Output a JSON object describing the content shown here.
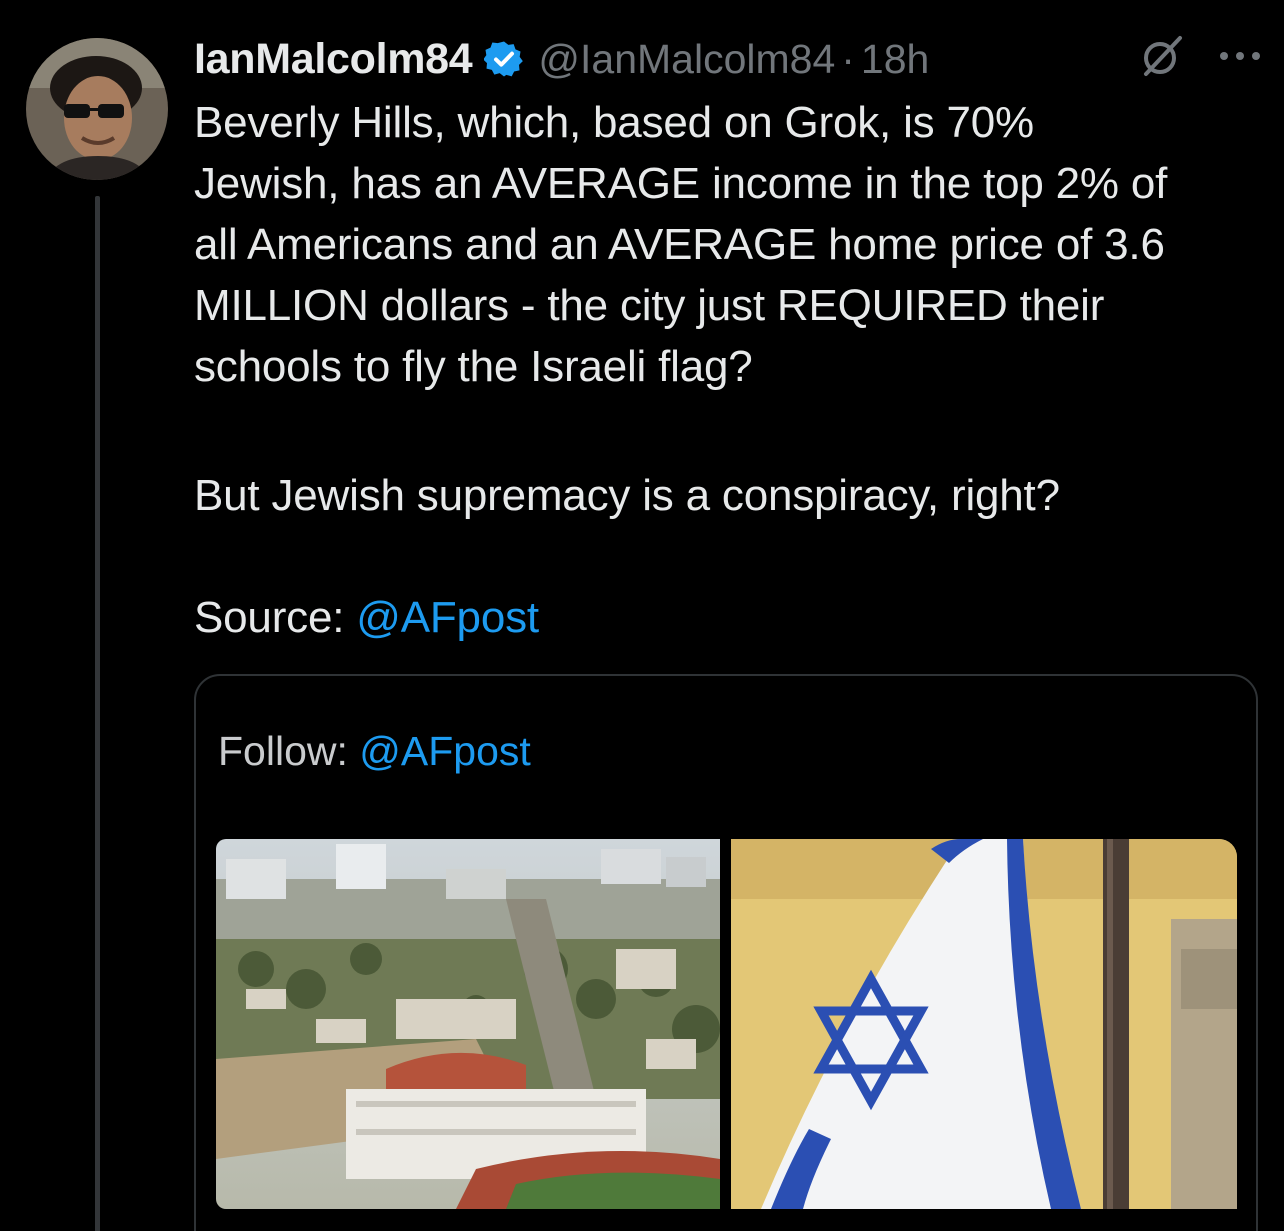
{
  "tweet": {
    "display_name": "IanMalcolm84",
    "handle": "@IanMalcolm84",
    "separator": "·",
    "time": "18h",
    "body_lines": [
      "Beverly Hills, which, based on Grok, is 70%",
      "Jewish, has an AVERAGE income in the top 2% of",
      "all Americans and an AVERAGE home price of 3.6",
      "MILLION dollars - the city just REQUIRED their",
      "schools to fly the Israeli flag?"
    ],
    "body_second": "But Jewish supremacy is a conspiracy, right?",
    "source_label": "Source: ",
    "source_mention": "@AFpost"
  },
  "card": {
    "caption_label": "Follow: ",
    "caption_mention": "@AFpost",
    "left_image": "aerial-city-school-photo",
    "right_image": "israeli-flag-photo"
  },
  "icons": {
    "verified": "verified-badge-icon",
    "grok": "grok-icon",
    "more": "more-options-icon"
  },
  "colors": {
    "background": "#000000",
    "text": "#e7e9ea",
    "muted": "#71767b",
    "accent": "#1d9bf0",
    "border": "#2f3336",
    "flag_blue": "#2b4fb3"
  }
}
